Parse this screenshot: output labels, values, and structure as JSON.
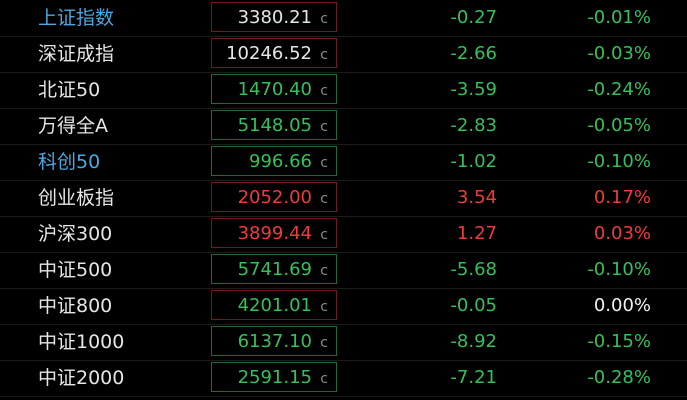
{
  "rows": [
    {
      "name": "上证指数",
      "name_style": "link",
      "price": "3380.21",
      "price_color": "white",
      "box": "red",
      "change": "-0.27",
      "change_color": "green",
      "pct": "-0.01%",
      "pct_color": "green",
      "icon": "c-icon"
    },
    {
      "name": "深证成指",
      "name_style": "normal",
      "price": "10246.52",
      "price_color": "white",
      "box": "red",
      "change": "-2.66",
      "change_color": "green",
      "pct": "-0.03%",
      "pct_color": "green",
      "icon": "c-icon"
    },
    {
      "name": "北证50",
      "name_style": "normal",
      "price": "1470.40",
      "price_color": "green",
      "box": "green",
      "change": "-3.59",
      "change_color": "green",
      "pct": "-0.24%",
      "pct_color": "green",
      "icon": "c-icon"
    },
    {
      "name": "万得全A",
      "name_style": "normal",
      "price": "5148.05",
      "price_color": "green",
      "box": "green",
      "change": "-2.83",
      "change_color": "green",
      "pct": "-0.05%",
      "pct_color": "green",
      "icon": "c-icon"
    },
    {
      "name": "科创50",
      "name_style": "link",
      "price": "996.66",
      "price_color": "green",
      "box": "green",
      "change": "-1.02",
      "change_color": "green",
      "pct": "-0.10%",
      "pct_color": "green",
      "icon": "c-icon"
    },
    {
      "name": "创业板指",
      "name_style": "normal",
      "price": "2052.00",
      "price_color": "red",
      "box": "red",
      "change": "3.54",
      "change_color": "red",
      "pct": "0.17%",
      "pct_color": "red",
      "icon": "c-icon"
    },
    {
      "name": "沪深300",
      "name_style": "normal",
      "price": "3899.44",
      "price_color": "red",
      "box": "red",
      "change": "1.27",
      "change_color": "red",
      "pct": "0.03%",
      "pct_color": "red",
      "icon": "c-icon"
    },
    {
      "name": "中证500",
      "name_style": "normal",
      "price": "5741.69",
      "price_color": "green",
      "box": "green",
      "change": "-5.68",
      "change_color": "green",
      "pct": "-0.10%",
      "pct_color": "green",
      "icon": "c-icon"
    },
    {
      "name": "中证800",
      "name_style": "normal",
      "price": "4201.01",
      "price_color": "green",
      "box": "red",
      "change": "-0.05",
      "change_color": "green",
      "pct": "0.00%",
      "pct_color": "white",
      "icon": "c-icon"
    },
    {
      "name": "中证1000",
      "name_style": "normal",
      "price": "6137.10",
      "price_color": "green",
      "box": "green",
      "change": "-8.92",
      "change_color": "green",
      "pct": "-0.15%",
      "pct_color": "green",
      "icon": "c-icon"
    },
    {
      "name": "中证2000",
      "name_style": "normal",
      "price": "2591.15",
      "price_color": "green",
      "box": "green",
      "change": "-7.21",
      "change_color": "green",
      "pct": "-0.28%",
      "pct_color": "green",
      "icon": "c-icon"
    }
  ],
  "c_glyph": "c",
  "colors": {
    "up": "#f03a3a",
    "down": "#33c15a",
    "flat": "#f0f0f0",
    "link": "#4aa8e0"
  }
}
